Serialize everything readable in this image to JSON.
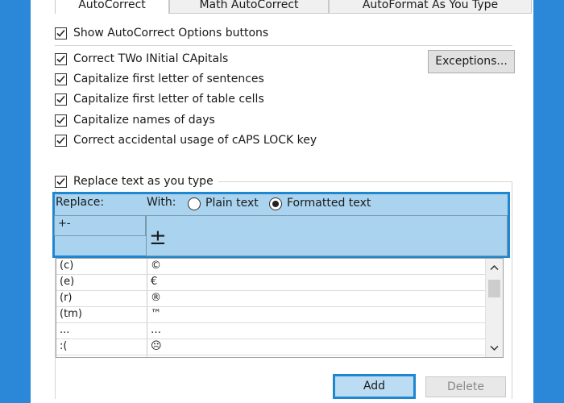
{
  "tabs": {
    "autocorrect": "AutoCorrect",
    "math": "Math AutoCorrect",
    "autoformat": "AutoFormat As You Type"
  },
  "options": {
    "show_buttons": {
      "label": "Show AutoCorrect Options buttons",
      "checked": true
    },
    "two_initial_caps": {
      "label": "Correct TWo INitial CApitals",
      "checked": true
    },
    "first_letter_sentences": {
      "label": "Capitalize first letter of sentences",
      "checked": true
    },
    "first_letter_table": {
      "label": "Capitalize first letter of table cells",
      "checked": true
    },
    "names_of_days": {
      "label": "Capitalize names of days",
      "checked": true
    },
    "caps_lock": {
      "label": "Correct accidental usage of cAPS LOCK key",
      "checked": true
    },
    "replace_as_you_type": {
      "label": "Replace text as you type",
      "checked": true
    }
  },
  "exceptions_button": "Exceptions...",
  "replace_panel": {
    "replace_label": "Replace:",
    "with_label": "With:",
    "plain_text": "Plain text",
    "formatted_text": "Formatted text",
    "selected_format": "formatted",
    "replace_value": "+-",
    "with_value": "±"
  },
  "entries": [
    {
      "replace": "(c)",
      "with": "©"
    },
    {
      "replace": "(e)",
      "with": "€"
    },
    {
      "replace": "(r)",
      "with": "®"
    },
    {
      "replace": "(tm)",
      "with": "™"
    },
    {
      "replace": "...",
      "with": "…"
    },
    {
      "replace": ":(",
      "with": "☹"
    }
  ],
  "buttons": {
    "add": "Add",
    "delete": "Delete"
  }
}
